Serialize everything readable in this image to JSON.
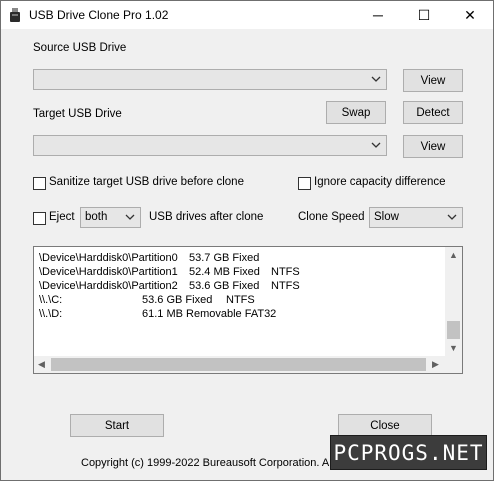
{
  "window": {
    "title": "USB Drive Clone Pro 1.02",
    "app_icon": "usb-drive-icon",
    "controls": {
      "minimize": "─",
      "maximize": "☐",
      "close": "✕"
    }
  },
  "source": {
    "label": "Source USB Drive",
    "selected": "",
    "view_label": "View"
  },
  "target": {
    "label": "Target USB Drive",
    "selected": "",
    "swap_label": "Swap",
    "detect_label": "Detect",
    "view_label": "View"
  },
  "options": {
    "sanitize_label": "Sanitize target USB drive before clone",
    "sanitize_checked": false,
    "ignore_capacity_label": "Ignore capacity difference",
    "ignore_capacity_checked": false,
    "eject_label": "Eject",
    "eject_checked": false,
    "eject_option": "both",
    "eject_suffix": "USB drives after clone",
    "speed_label": "Clone Speed",
    "speed_option": "Slow"
  },
  "partitions": [
    {
      "name": "\\Device\\Harddisk0\\Partition0",
      "size": "53.7 GB Fixed",
      "fs": ""
    },
    {
      "name": "\\Device\\Harddisk0\\Partition1",
      "size": "52.4 MB Fixed",
      "fs": "NTFS"
    },
    {
      "name": "\\Device\\Harddisk0\\Partition2",
      "size": "53.6 GB Fixed",
      "fs": "NTFS"
    },
    {
      "name": "\\\\.\\C:",
      "size": "53.6 GB Fixed",
      "fs": "NTFS"
    },
    {
      "name": "\\\\.\\D:",
      "size": "61.1 MB Removable FAT32",
      "fs": ""
    }
  ],
  "actions": {
    "start_label": "Start",
    "close_label": "Close"
  },
  "footer": {
    "copyright": "Copyright (c) 1999-2022 Bureausoft Corporation. All Rights Reserved."
  },
  "watermark": {
    "text": "PCPROGS.NET"
  },
  "colors": {
    "window_bg": "#f0f0f0",
    "button_bg": "#e1e1e1",
    "watermark_bg": "#3c3c3c"
  }
}
